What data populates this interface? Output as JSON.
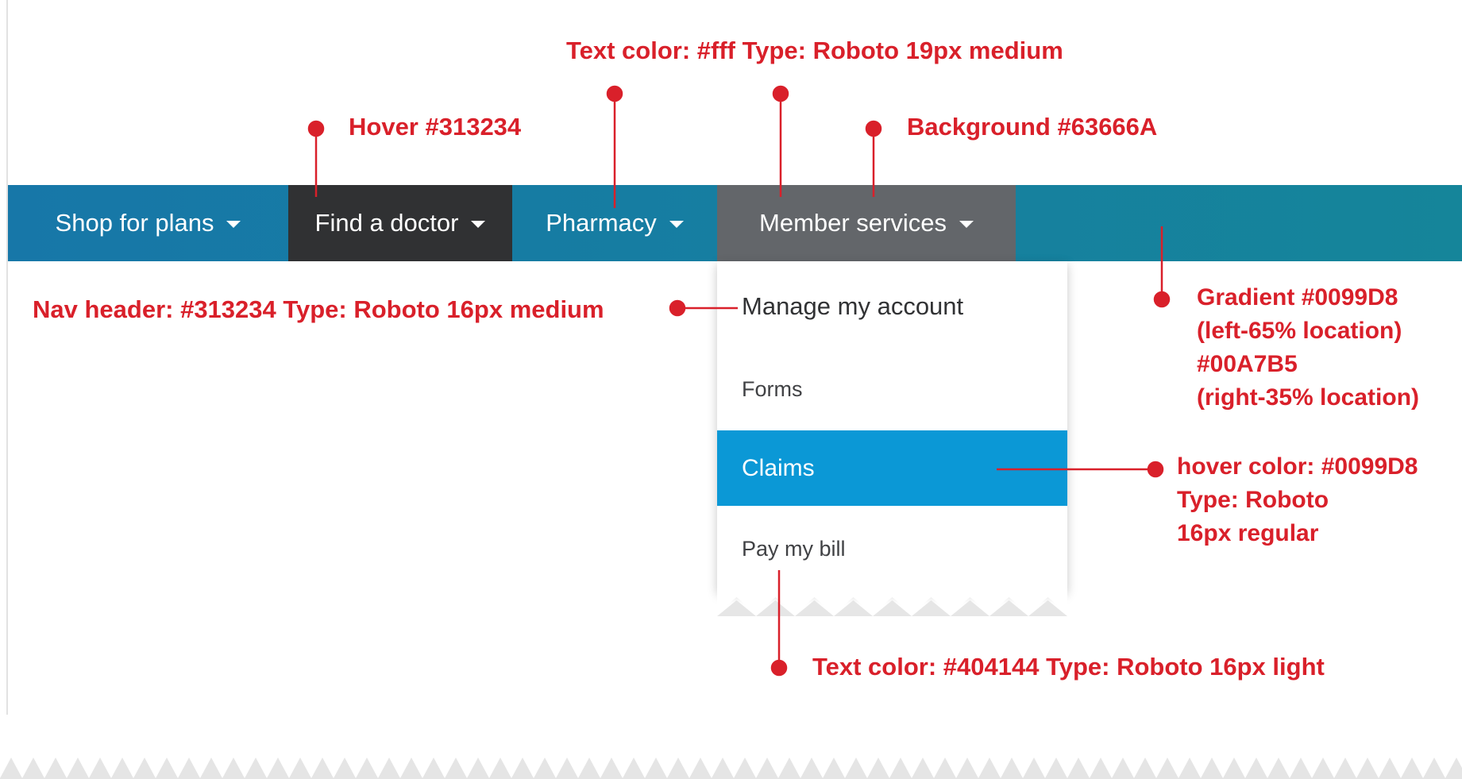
{
  "nav": {
    "items": [
      {
        "label": "Shop for plans"
      },
      {
        "label": "Find a doctor"
      },
      {
        "label": "Pharmacy"
      },
      {
        "label": "Member services"
      }
    ]
  },
  "dropdown": {
    "header": "Manage my account",
    "items": [
      "Forms",
      "Claims",
      "Pay my bill"
    ]
  },
  "annotations": {
    "text_color_nav": "Text color: #fff  Type: Roboto 19px medium",
    "hover_nav": "Hover #313234",
    "background_active": "Background #63666A",
    "nav_header": "Nav header: #313234  Type: Roboto 16px medium",
    "gradient": [
      "Gradient #0099D8",
      "(left-65% location)",
      "#00A7B5",
      "(right-35% location)"
    ],
    "hover_dropdown": [
      "hover color: #0099D8",
      "Type: Roboto",
      "16px regular"
    ],
    "text_color_dropdown": "Text color: #404144  Type: Roboto 16px light"
  },
  "colors": {
    "nav_gradient_start": "#0099D8",
    "nav_gradient_end": "#00A7B5",
    "nav_hover": "#313234",
    "nav_active_bg": "#63666A",
    "dropdown_hover": "#0099D8",
    "dropdown_text": "#404144",
    "annotation": "#d9202a"
  }
}
